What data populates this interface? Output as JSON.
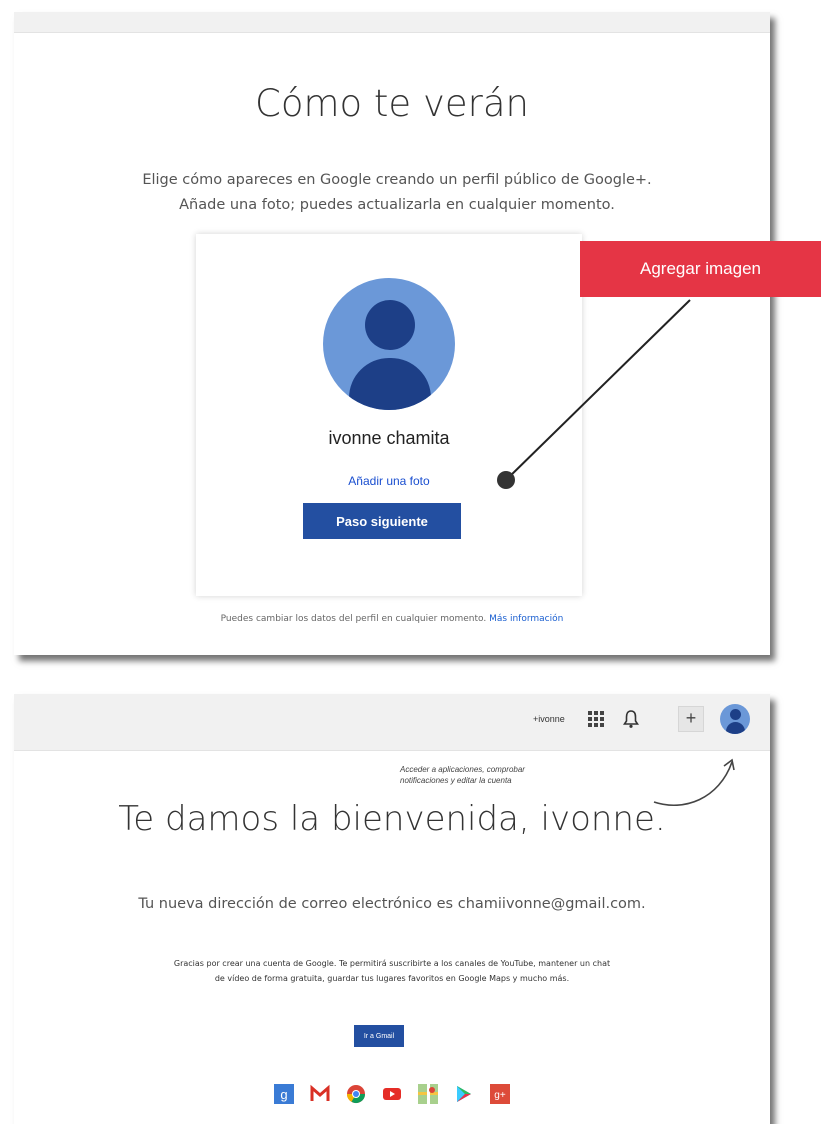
{
  "panel1": {
    "title": "Cómo te verán",
    "subtitle_line1": "Elige cómo apareces en Google creando un perfil público de Google+.",
    "subtitle_line2": "Añade una foto; puedes actualizarla en cualquier momento.",
    "profile_name": "ivonne chamita",
    "add_photo_link": "Añadir una foto",
    "next_button": "Paso siguiente",
    "footer_text": "Puedes cambiar los datos del perfil en cualquier momento.",
    "footer_link": "Más información"
  },
  "annotation": {
    "callout_label": "Agregar imagen",
    "callout_color": "#e53545"
  },
  "panel2": {
    "topbar": {
      "user_label": "+ivonne",
      "icons": [
        "apps-grid-icon",
        "bell-icon",
        "plus-icon",
        "avatar"
      ]
    },
    "note_line1": "Acceder a aplicaciones, comprobar",
    "note_line2": "notificaciones y editar la cuenta",
    "title": "Te damos la bienvenida, ivonne.",
    "email_text": "Tu nueva dirección de correo electrónico es chamiivonne@gmail.com.",
    "desc_line1": "Gracias por crear una cuenta de Google. Te permitirá suscribirte a los canales de YouTube, mantener un chat",
    "desc_line2": "de vídeo de forma gratuita, guardar tus lugares favoritos en Google Maps y mucho más.",
    "gmail_button": "Ir a Gmail",
    "app_icons": [
      "google-search-icon",
      "gmail-icon",
      "chrome-icon",
      "youtube-icon",
      "maps-icon",
      "play-store-icon",
      "google-plus-icon"
    ]
  },
  "colors": {
    "primary_button": "#234fa1",
    "avatar_light": "#6b98d8",
    "avatar_dark": "#1d3f87",
    "link": "#1a4fd0"
  }
}
